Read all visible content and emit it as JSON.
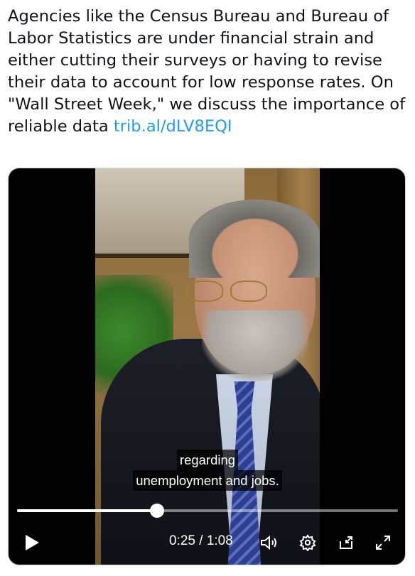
{
  "tweet": {
    "text": "Agencies like the Census Bureau and Bureau of Labor Statistics are under financial strain and either cutting their surveys or having to revise their data to account for low response rates. On \"Wall Street Week,\" we discuss the importance of reliable data ",
    "link_text": "trib.al/dLV8EQI"
  },
  "video": {
    "caption_line1": "regarding",
    "caption_line2": "unemployment and jobs.",
    "current_time": "0:25",
    "separator": "/",
    "duration": "1:08",
    "progress_fraction": 0.368
  },
  "icons": {
    "play": "play-icon",
    "volume": "volume-icon",
    "settings": "gear-icon",
    "dock": "dock-icon",
    "fullscreen": "fullscreen-icon"
  },
  "colors": {
    "link": "#1d9bf0",
    "text": "#0f1419",
    "player_bg": "#000000"
  }
}
